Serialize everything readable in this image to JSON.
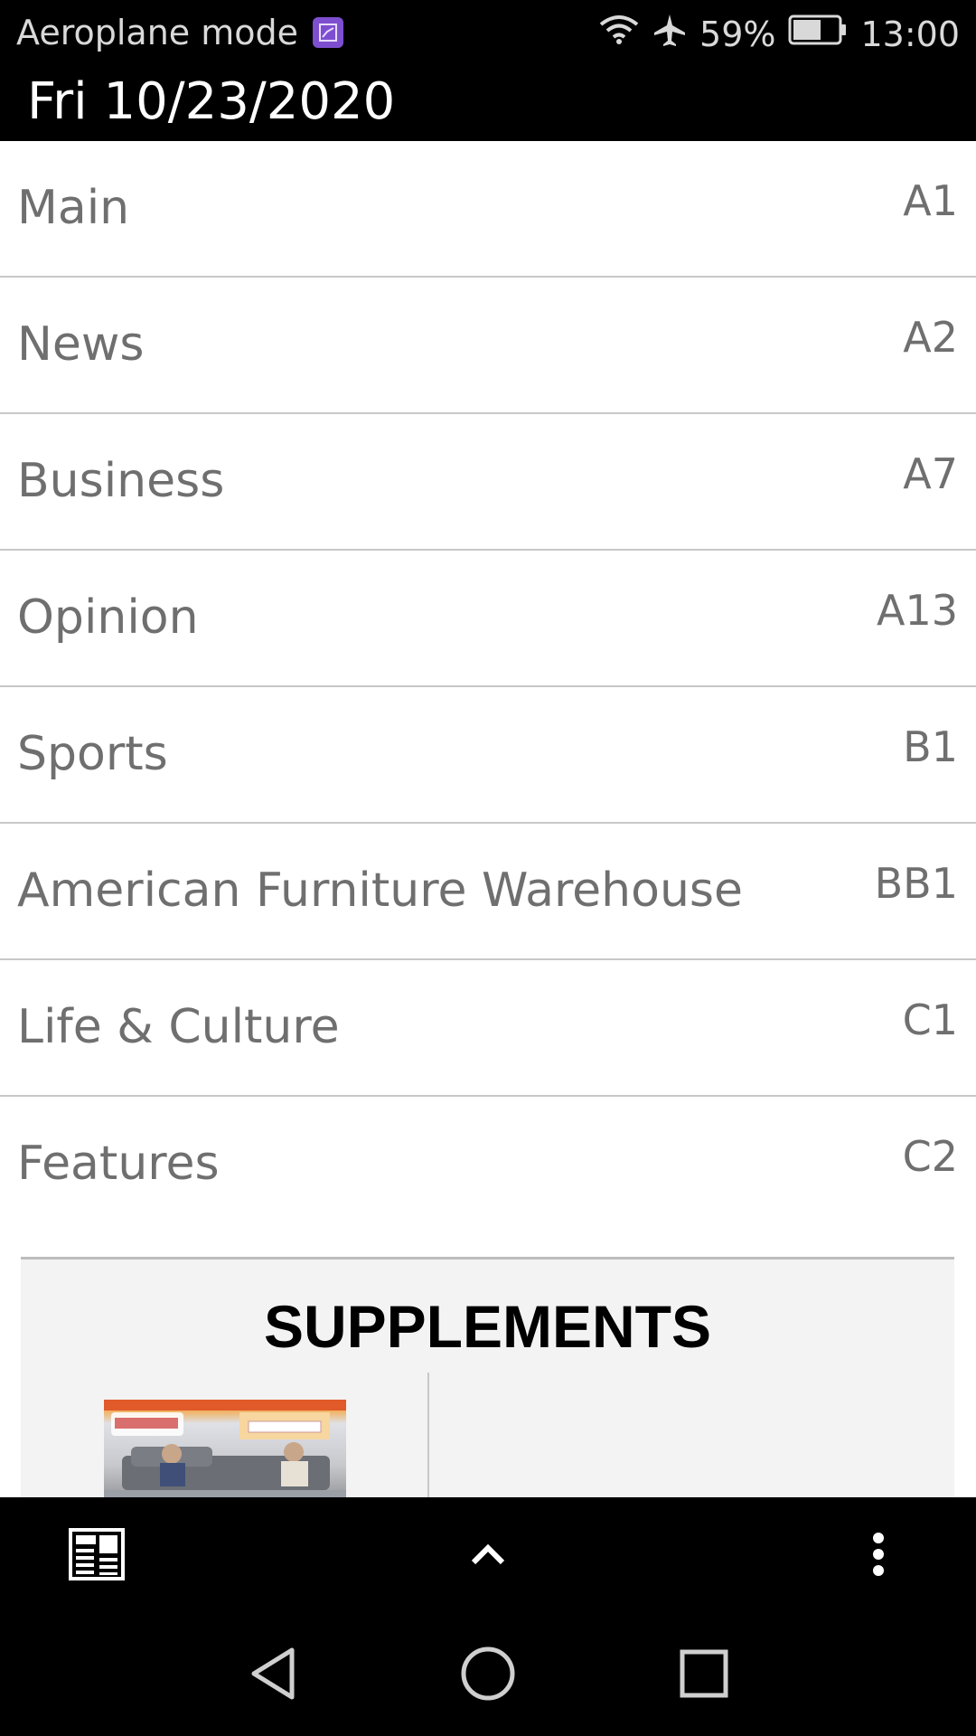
{
  "status_bar": {
    "mode_label": "Aeroplane mode",
    "battery_percent": "59%",
    "time": "13:00",
    "icons": [
      "gallery-icon",
      "wifi-icon",
      "airplane-icon",
      "battery-icon"
    ]
  },
  "header": {
    "date": "Fri 10/23/2020"
  },
  "sections": [
    {
      "name": "Main",
      "page": "A1"
    },
    {
      "name": "News",
      "page": "A2"
    },
    {
      "name": "Business",
      "page": "A7"
    },
    {
      "name": "Opinion",
      "page": "A13"
    },
    {
      "name": "Sports",
      "page": "B1"
    },
    {
      "name": "American Furniture Warehouse",
      "page": "BB1"
    },
    {
      "name": "Life & Culture",
      "page": "C1"
    },
    {
      "name": "Features",
      "page": "C2"
    }
  ],
  "supplements": {
    "title": "SUPPLEMENTS"
  },
  "bottom_nav": {
    "icons": [
      "newspaper-icon",
      "chevron-up-icon",
      "more-vert-icon"
    ]
  },
  "system_nav": {
    "icons": [
      "back-icon",
      "home-icon",
      "recents-icon"
    ]
  },
  "colors": {
    "bar_background": "#000000",
    "row_text": "#6f6f6f",
    "divider": "#c8c8c8",
    "supplements_bg": "#f3f3f3"
  }
}
